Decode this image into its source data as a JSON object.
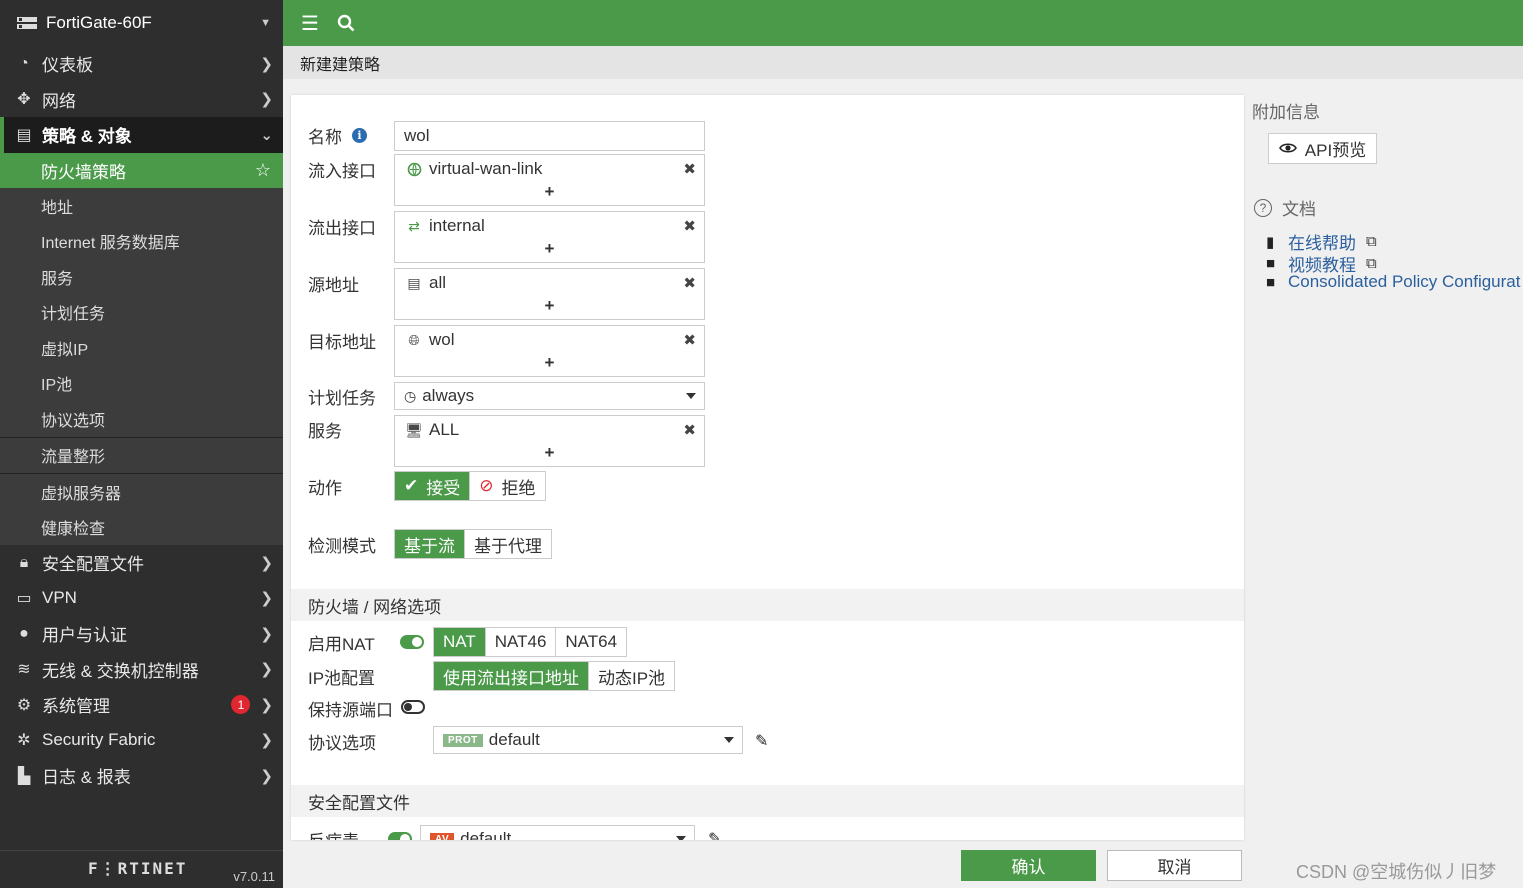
{
  "sidebar": {
    "device": "FortiGate-60F",
    "items": [
      {
        "label": "仪表板"
      },
      {
        "label": "网络"
      },
      {
        "label": "策略 & 对象"
      }
    ],
    "subitems": [
      {
        "label": "防火墙策略"
      },
      {
        "label": "地址"
      },
      {
        "label": "Internet 服务数据库"
      },
      {
        "label": "服务"
      },
      {
        "label": "计划任务"
      },
      {
        "label": "虚拟IP"
      },
      {
        "label": "IP池"
      },
      {
        "label": "协议选项"
      },
      {
        "label": "流量整形"
      },
      {
        "label": "虚拟服务器"
      },
      {
        "label": "健康检查"
      }
    ],
    "more": [
      {
        "label": "安全配置文件"
      },
      {
        "label": "VPN"
      },
      {
        "label": "用户与认证"
      },
      {
        "label": "无线 & 交换机控制器"
      },
      {
        "label": "系统管理",
        "badge": "1"
      },
      {
        "label": "Security Fabric"
      },
      {
        "label": "日志 & 报表"
      }
    ],
    "brand": "F⋮RTINET",
    "version": "v7.0.11"
  },
  "page_title": "新建建策略",
  "form": {
    "name_label": "名称",
    "name_value": "wol",
    "in_if_label": "流入接口",
    "in_if_value": "virtual-wan-link",
    "out_if_label": "流出接口",
    "out_if_value": "internal",
    "src_label": "源地址",
    "src_value": "all",
    "dst_label": "目标地址",
    "dst_value": "wol",
    "schedule_label": "计划任务",
    "schedule_value": "always",
    "service_label": "服务",
    "service_value": "ALL",
    "action_label": "动作",
    "action_accept": "接受",
    "action_deny": "拒绝",
    "inspect_label": "检测模式",
    "inspect_flow": "基于流",
    "inspect_proxy": "基于代理",
    "fw_section": "防火墙 / 网络选项",
    "nat_label": "启用NAT",
    "nat_options": [
      "NAT",
      "NAT46",
      "NAT64"
    ],
    "ippool_label": "IP池配置",
    "ippool_use_out": "使用流出接口地址",
    "ippool_dynamic": "动态IP池",
    "preserve_port_label": "保持源端口",
    "protocol_label": "协议选项",
    "protocol_tag": "PROT",
    "protocol_value": "default",
    "sec_section": "安全配置文件",
    "av_label": "反病毒",
    "av_tag": "AV",
    "av_value": "default"
  },
  "right": {
    "extra_info": "附加信息",
    "api_preview": "API预览",
    "docs": "文档",
    "online_help": "在线帮助",
    "video": "视频教程",
    "consolidated": "Consolidated Policy Configurat"
  },
  "buttons": {
    "ok": "确认",
    "cancel": "取消"
  },
  "watermark": "CSDN @空城伤似丿旧梦",
  "colors": {
    "accent_green": "#4a9a4a",
    "sidebar_bg": "#2e2e2e",
    "link_blue": "#2b5f9e",
    "badge_red": "#e0262f",
    "av_orange": "#e0552b"
  }
}
